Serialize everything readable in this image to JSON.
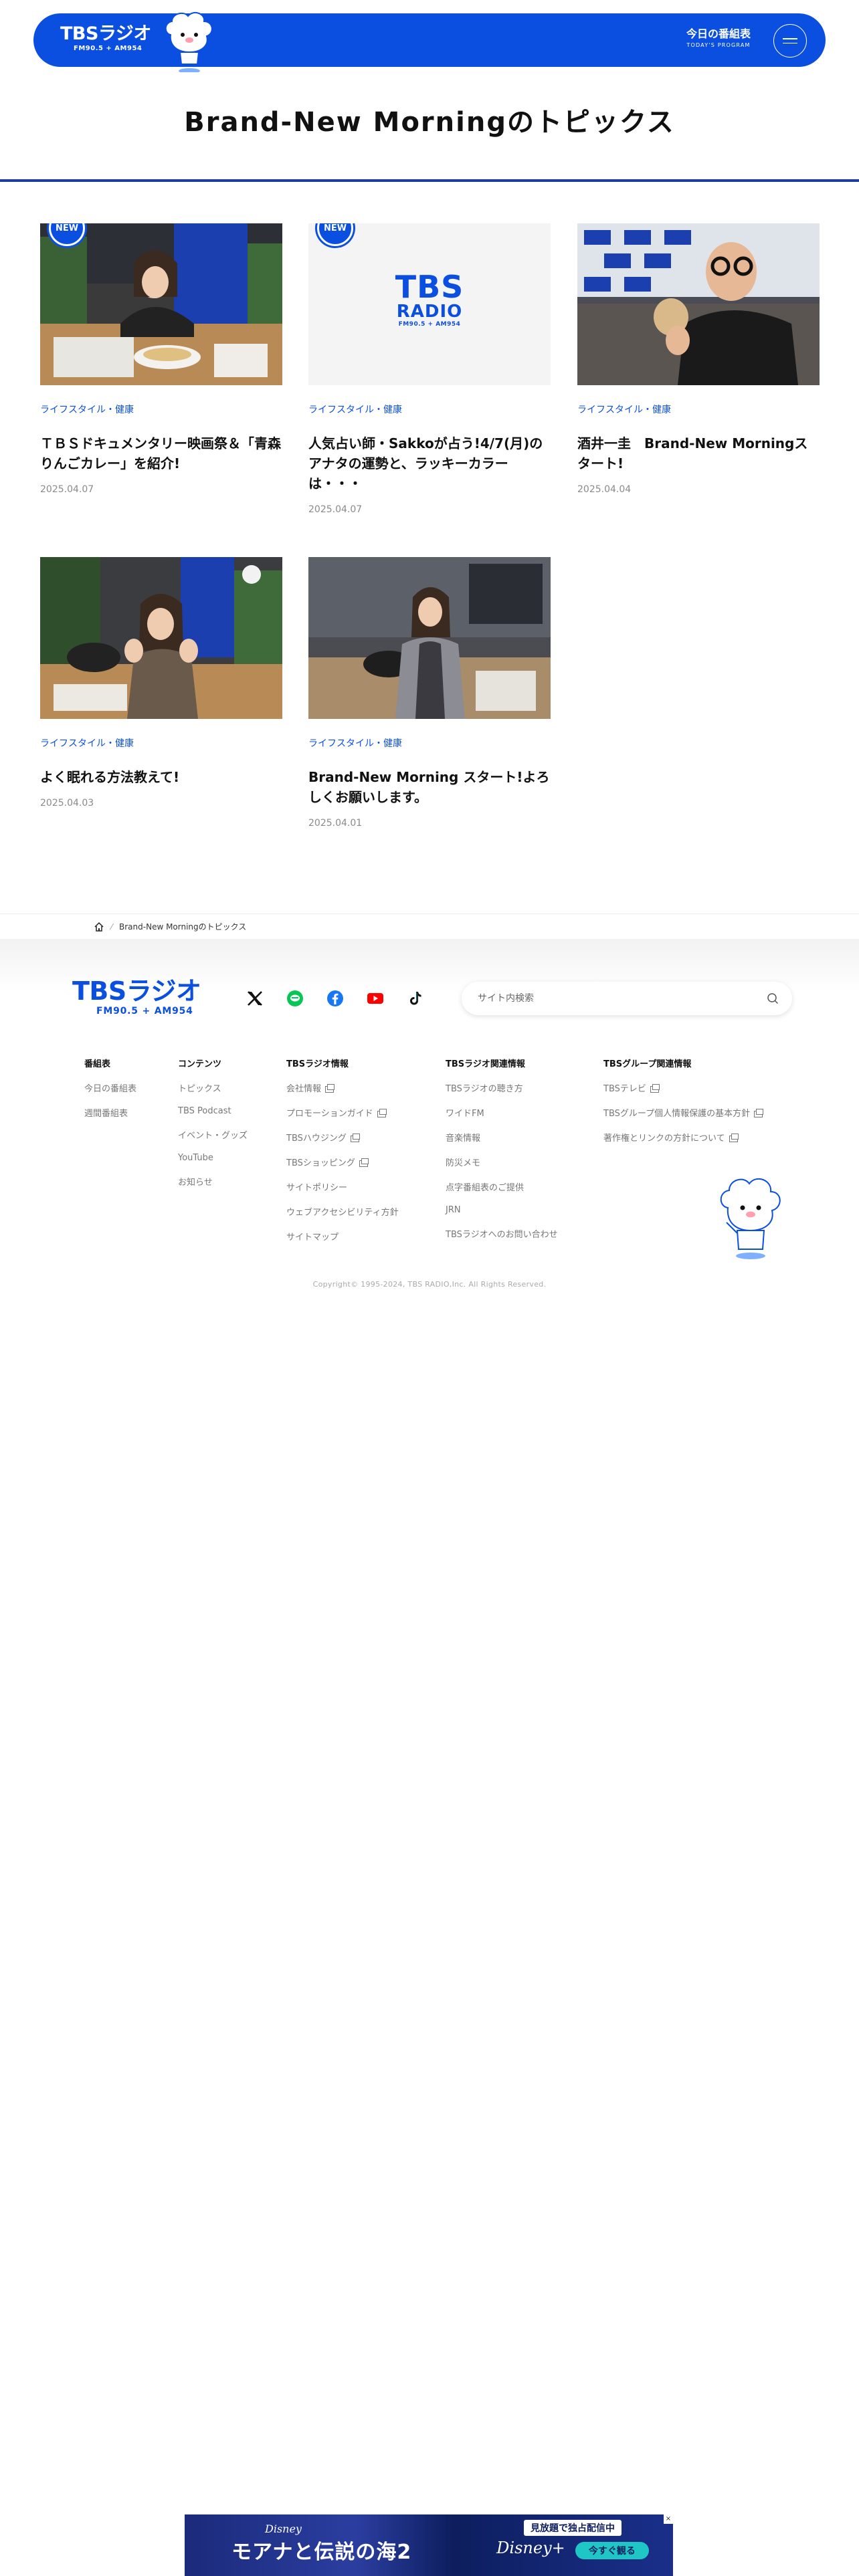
{
  "header": {
    "logo_main": "TBSラジオ",
    "logo_sub": "FM90.5 + AM954",
    "program_label": "今日の番組表",
    "program_sub": "TODAY'S PROGRAM"
  },
  "page_title": "Brand-New Morningのトピックス",
  "articles": [
    {
      "badge": "NEW",
      "category": "ライフスタイル・健康",
      "title": "ＴＢＳドキュメンタリー映画祭＆「青森りんごカレー」を紹介!",
      "date": "2025.04.07"
    },
    {
      "badge": "NEW",
      "category": "ライフスタイル・健康",
      "title": "人気占い師・Sakkoが占う!4/7(月)のアナタの運勢と、ラッキーカラーは・・・",
      "date": "2025.04.07",
      "image_logo": "TBS",
      "image_sub1": "RADIO",
      "image_sub2": "FM90.5 + AM954"
    },
    {
      "badge": "",
      "category": "ライフスタイル・健康",
      "title": "酒井一圭　Brand-New Morningスタート!",
      "date": "2025.04.04"
    },
    {
      "badge": "",
      "category": "ライフスタイル・健康",
      "title": "よく眠れる方法教えて!",
      "date": "2025.04.03"
    },
    {
      "badge": "",
      "category": "ライフスタイル・健康",
      "title": "Brand-New Morning スタート!よろしくお願いします。",
      "date": "2025.04.01"
    }
  ],
  "breadcrumb": {
    "current": "Brand-New Morningのトピックス"
  },
  "footer": {
    "logo_main": "TBSラジオ",
    "logo_sub": "FM90.5 + AM954",
    "search_placeholder": "サイト内検索",
    "columns": [
      {
        "heading": "番組表",
        "links": [
          {
            "label": "今日の番組表",
            "ext": false
          },
          {
            "label": "週間番組表",
            "ext": false
          }
        ]
      },
      {
        "heading": "コンテンツ",
        "links": [
          {
            "label": "トピックス",
            "ext": false
          },
          {
            "label": "TBS Podcast",
            "ext": false
          },
          {
            "label": "イベント・グッズ",
            "ext": false
          },
          {
            "label": "YouTube",
            "ext": false
          },
          {
            "label": "お知らせ",
            "ext": false
          }
        ]
      },
      {
        "heading": "TBSラジオ情報",
        "links": [
          {
            "label": "会社情報",
            "ext": true
          },
          {
            "label": "プロモーションガイド",
            "ext": true
          },
          {
            "label": "TBSハウジング",
            "ext": true
          },
          {
            "label": "TBSショッピング",
            "ext": true
          },
          {
            "label": "サイトポリシー",
            "ext": false
          },
          {
            "label": "ウェブアクセシビリティ方針",
            "ext": false
          },
          {
            "label": "サイトマップ",
            "ext": false
          }
        ]
      },
      {
        "heading": "TBSラジオ関連情報",
        "links": [
          {
            "label": "TBSラジオの聴き方",
            "ext": false
          },
          {
            "label": "ワイドFM",
            "ext": false
          },
          {
            "label": "音楽情報",
            "ext": false
          },
          {
            "label": "防災メモ",
            "ext": false
          },
          {
            "label": "点字番組表のご提供",
            "ext": false
          },
          {
            "label": "JRN",
            "ext": false
          },
          {
            "label": "TBSラジオへのお問い合わせ",
            "ext": false
          }
        ]
      },
      {
        "heading": "TBSグループ関連情報",
        "links": [
          {
            "label": "TBSテレビ",
            "ext": true
          },
          {
            "label": "TBSグループ個人情報保護の基本方針",
            "ext": true
          },
          {
            "label": "著作権とリンクの方針について",
            "ext": true
          }
        ]
      }
    ],
    "copyright": "Copyright© 1995-2024, TBS RADIO,Inc. All Rights Reserved."
  },
  "ad": {
    "brand_small": "Disney",
    "title": "モアナと伝説の海2",
    "tag": "見放題で独占配信中",
    "brand": "Disney+",
    "cta": "今すぐ観る",
    "close": "×"
  },
  "colors": {
    "brand_blue": "#0b4fe0",
    "rule_blue": "#1d3d9f"
  }
}
